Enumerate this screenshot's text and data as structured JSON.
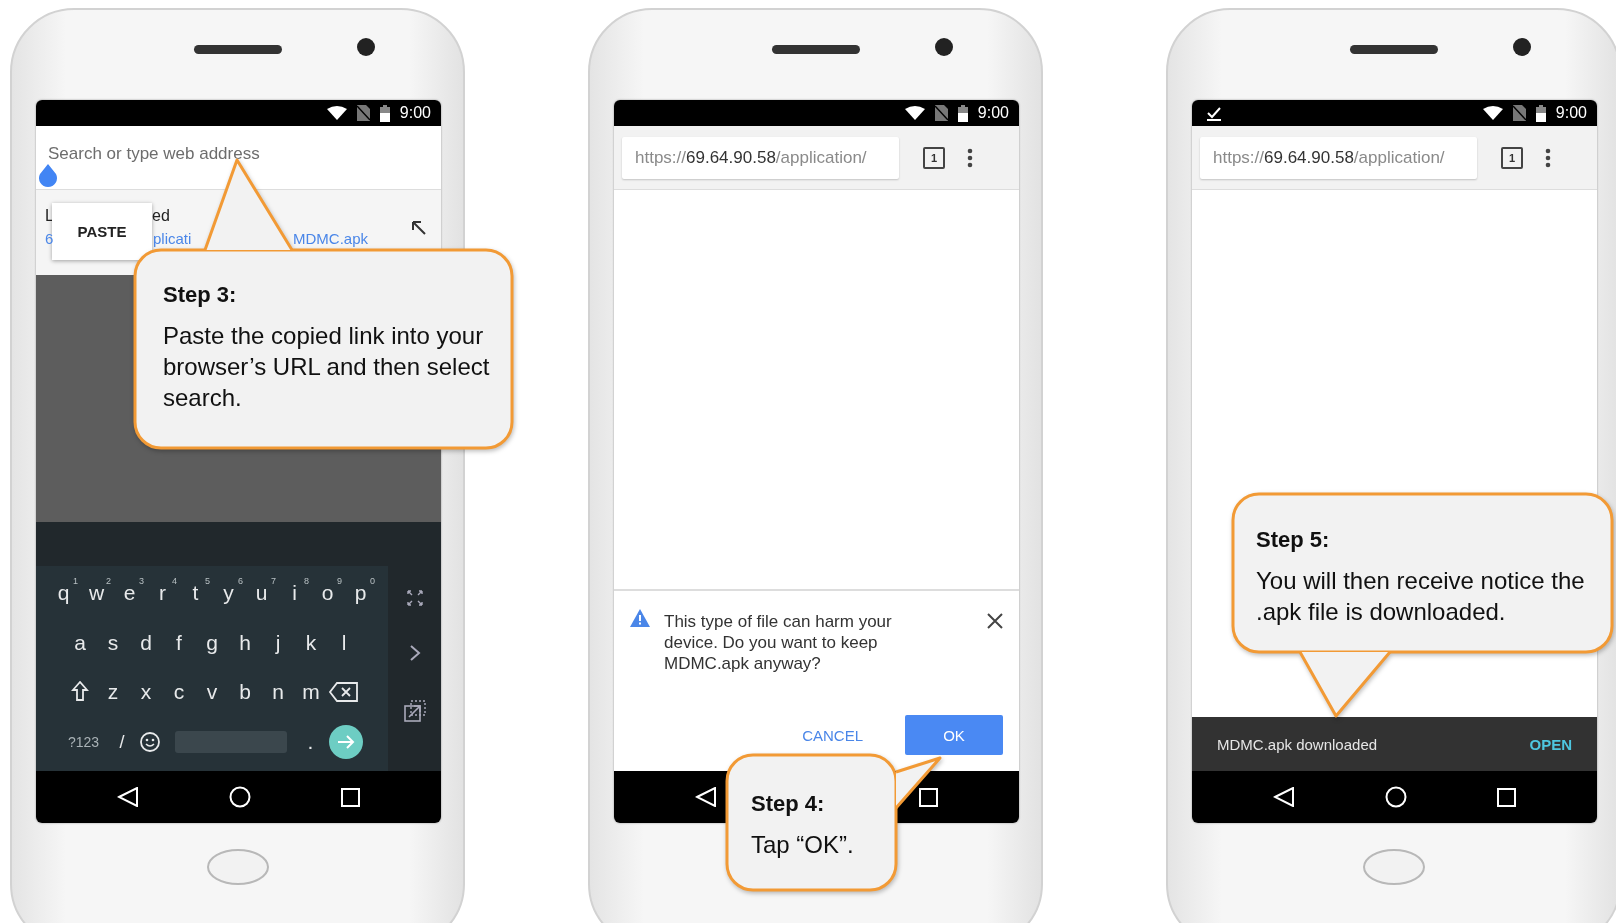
{
  "panels": [
    {
      "kind": "omnibox",
      "status_bar": {
        "time": "9:00",
        "download_notification": false
      },
      "address_bar": {
        "placeholder": "Search or type web address"
      },
      "suggestion": {
        "title_fragments": [
          "L",
          "ed"
        ],
        "url_fragments": [
          "6",
          "plicati",
          "MDMC.apk"
        ]
      },
      "paste_menu": {
        "label": "PASTE"
      },
      "keyboard": {
        "rows": [
          [
            {
              "label": "q",
              "hint": "1"
            },
            {
              "label": "w",
              "hint": "2"
            },
            {
              "label": "e",
              "hint": "3"
            },
            {
              "label": "r",
              "hint": "4"
            },
            {
              "label": "t",
              "hint": "5"
            },
            {
              "label": "y",
              "hint": "6"
            },
            {
              "label": "u",
              "hint": "7"
            },
            {
              "label": "i",
              "hint": "8"
            },
            {
              "label": "o",
              "hint": "9"
            },
            {
              "label": "p",
              "hint": "0"
            }
          ],
          [
            {
              "label": "a"
            },
            {
              "label": "s"
            },
            {
              "label": "d"
            },
            {
              "label": "f"
            },
            {
              "label": "g"
            },
            {
              "label": "h"
            },
            {
              "label": "j"
            },
            {
              "label": "k"
            },
            {
              "label": "l"
            }
          ],
          [
            {
              "label": "z"
            },
            {
              "label": "x"
            },
            {
              "label": "c"
            },
            {
              "label": "v"
            },
            {
              "label": "b"
            },
            {
              "label": "n"
            },
            {
              "label": "m"
            }
          ]
        ],
        "symbols_key": "?123",
        "slash_key": "/",
        "period_key": "."
      },
      "callout": {
        "title": "Step 3:",
        "text": "Paste the copied link into your browser’s URL and then select search."
      }
    },
    {
      "kind": "warning",
      "status_bar": {
        "time": "9:00",
        "download_notification": false
      },
      "address_bar": {
        "url_scheme": "https://",
        "url_host": "69.64.90.58",
        "url_path": "/application/"
      },
      "tab_count": "1",
      "dialog": {
        "message": "This type of file can harm your device. Do you want to keep MDMC.apk anyway?",
        "buttons": [
          {
            "label": "CANCEL",
            "kind": "text"
          },
          {
            "label": "OK",
            "kind": "primary"
          }
        ]
      },
      "callout": {
        "title": "Step 4:",
        "text": "Tap “OK”."
      }
    },
    {
      "kind": "downloaded",
      "status_bar": {
        "time": "9:00",
        "download_notification": true
      },
      "address_bar": {
        "url_scheme": "https://",
        "url_host": "69.64.90.58",
        "url_path": "/application/"
      },
      "tab_count": "1",
      "snackbar": {
        "message": "MDMC.apk downloaded",
        "action": "OPEN"
      },
      "callout": {
        "title": "Step 5:",
        "text": "You will then receive notice the .apk file is downloaded."
      }
    }
  ]
}
